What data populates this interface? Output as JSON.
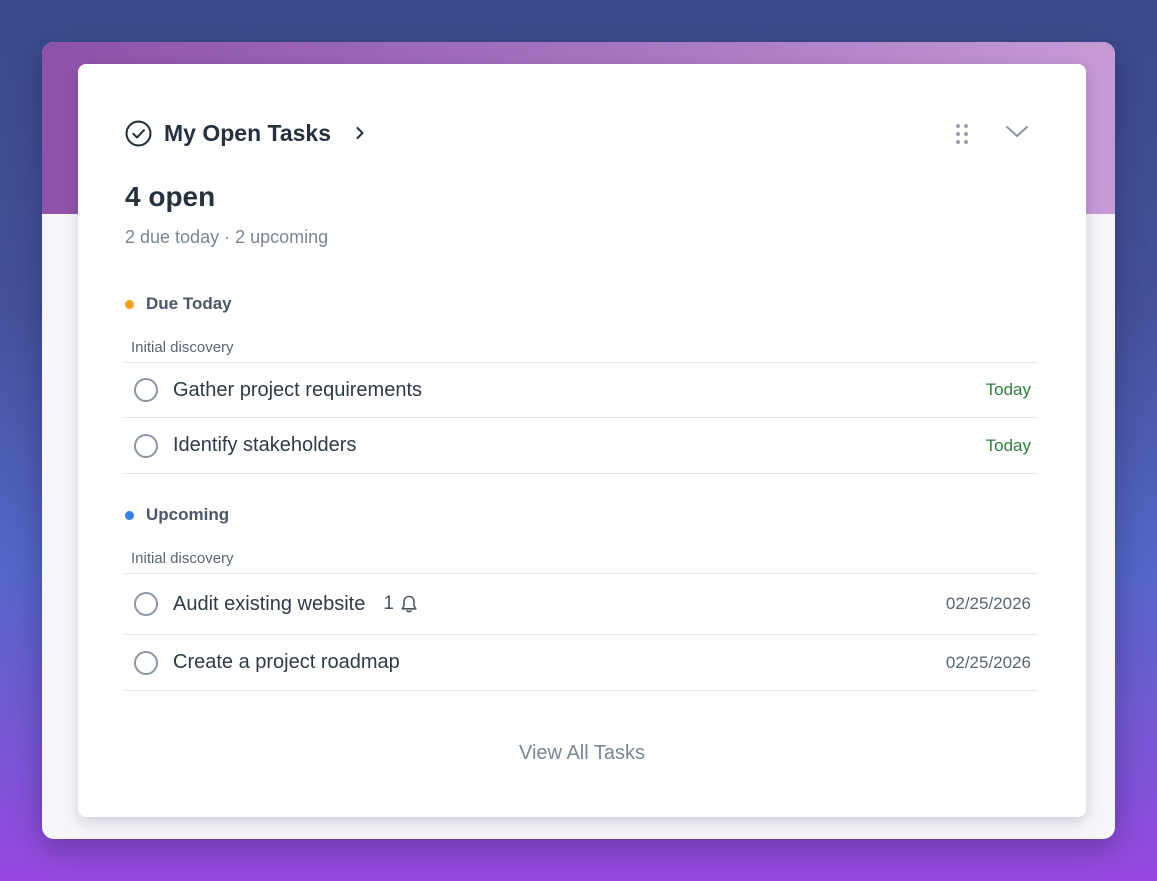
{
  "widget": {
    "title": "My Open Tasks",
    "title_icon": "check-circle-icon",
    "nav_icon": "chevron-right-icon",
    "drag_icon": "drag-handle-icon",
    "collapse_icon": "chevron-down-icon",
    "count_label": "4 open",
    "summary": "2 due today · 2 upcoming"
  },
  "sections": [
    {
      "label": "Due Today",
      "dot_color": "#f0a020",
      "group": "Initial discovery",
      "tasks": [
        {
          "title": "Gather project requirements",
          "due": "Today"
        },
        {
          "title": "Identify stakeholders",
          "due": "Today"
        }
      ]
    },
    {
      "label": "Upcoming",
      "dot_color": "#3a7de0",
      "group": "Initial discovery",
      "tasks": [
        {
          "title": "Audit existing website",
          "reminder_count": "1",
          "reminder_icon": "bell-icon",
          "due": "02/25/2026"
        },
        {
          "title": "Create a project roadmap",
          "due": "02/25/2026"
        }
      ]
    }
  ],
  "footer": {
    "view_all_label": "View All Tasks"
  },
  "colors": {
    "due_today": "#2f7d3a",
    "header_band": "#a676c2",
    "background": "#44519a"
  }
}
